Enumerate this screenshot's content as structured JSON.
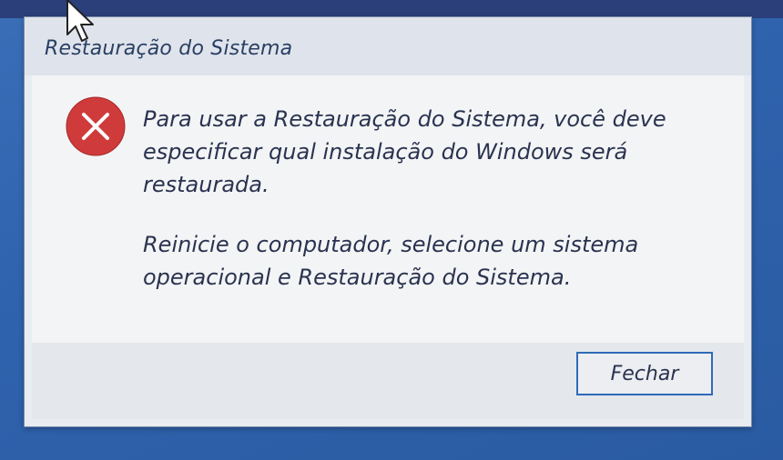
{
  "dialog": {
    "title": "Restauração do Sistema",
    "icon": "error-icon",
    "message_line1": "Para usar a Restauração do Sistema, você deve especificar qual instalação do Windows será restaurada.",
    "message_line2": "Reinicie o computador, selecione um sistema operacional e Restauração do Sistema.",
    "close_label": "Fechar"
  },
  "colors": {
    "desktop": "#2f63ad",
    "error_red": "#cf3b3b",
    "button_border": "#2f6ab8",
    "text": "#2a3350"
  }
}
